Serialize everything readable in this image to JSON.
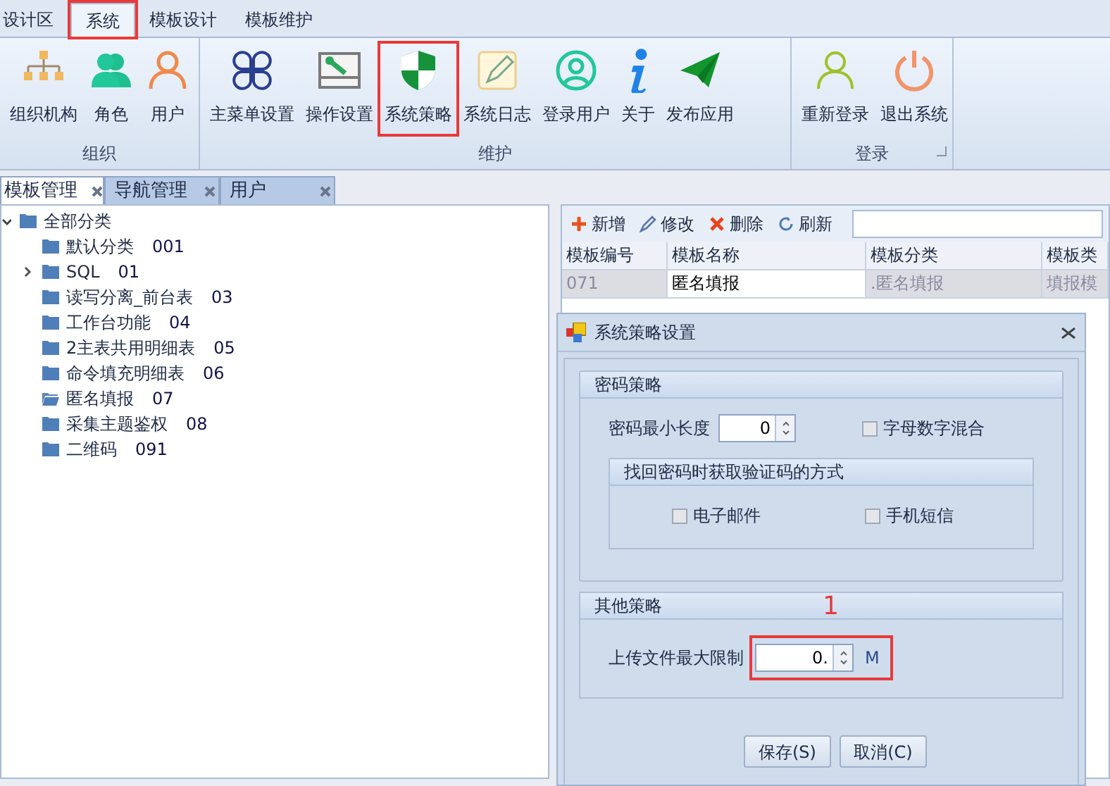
{
  "ribbon_tabs": [
    {
      "label": "设计区",
      "selected": false
    },
    {
      "label": "系统",
      "selected": true,
      "highlighted": true
    },
    {
      "label": "模板设计",
      "selected": false
    },
    {
      "label": "模板维护",
      "selected": false
    }
  ],
  "ribbon_groups": [
    {
      "label": "组织",
      "buttons": [
        {
          "label": "组织机构",
          "highlighted": false
        },
        {
          "label": "角色",
          "highlighted": false
        },
        {
          "label": "用户",
          "highlighted": false
        }
      ]
    },
    {
      "label": "维护",
      "buttons": [
        {
          "label": "主菜单设置",
          "highlighted": false
        },
        {
          "label": "操作设置",
          "highlighted": false
        },
        {
          "label": "系统策略",
          "highlighted": true
        },
        {
          "label": "系统日志",
          "highlighted": false
        },
        {
          "label": "登录用户",
          "highlighted": false
        },
        {
          "label": "关于",
          "highlighted": false
        },
        {
          "label": "发布应用",
          "highlighted": false
        }
      ]
    },
    {
      "label": "登录",
      "buttons": [
        {
          "label": "重新登录",
          "highlighted": false
        },
        {
          "label": "退出系统",
          "highlighted": false
        }
      ]
    }
  ],
  "doc_tabs": [
    {
      "label": "模板管理",
      "selected": true
    },
    {
      "label": "导航管理",
      "selected": false
    },
    {
      "label": "用户",
      "selected": false
    }
  ],
  "tree": {
    "label": "全部分类",
    "expanded": true,
    "children": [
      {
        "label": "默认分类",
        "code": "001",
        "expandable": false,
        "selected": false
      },
      {
        "label": "SQL",
        "code": "01",
        "expandable": true,
        "selected": false
      },
      {
        "label": "读写分离_前台表",
        "code": "03",
        "expandable": false,
        "selected": false
      },
      {
        "label": "工作台功能",
        "code": "04",
        "expandable": false,
        "selected": false
      },
      {
        "label": "2主表共用明细表",
        "code": "05",
        "expandable": false,
        "selected": false
      },
      {
        "label": "命令填充明细表",
        "code": "06",
        "expandable": false,
        "selected": false
      },
      {
        "label": "匿名填报",
        "code": "07",
        "expandable": false,
        "selected": true
      },
      {
        "label": "采集主题鉴权",
        "code": "08",
        "expandable": false,
        "selected": false
      },
      {
        "label": "二维码",
        "code": "091",
        "expandable": false,
        "selected": false
      }
    ]
  },
  "toolbar": [
    "新增",
    "修改",
    "删除",
    "刷新"
  ],
  "table": {
    "columns": [
      "模板编号",
      "模板名称",
      "模板分类",
      "模板类"
    ],
    "rows": [
      {
        "cells": [
          "071",
          "匿名填报",
          ".匿名填报",
          "填报模"
        ],
        "selected": true
      }
    ]
  },
  "dialog": {
    "title": "系统策略设置",
    "password_policy": {
      "title": "密码策略",
      "min_length_label": "密码最小长度",
      "min_length": "0",
      "mixed_label": "字母数字混合",
      "mixed": false,
      "recovery": {
        "title": "找回密码时获取验证码的方式",
        "options": [
          {
            "label": "电子邮件",
            "checked": false
          },
          {
            "label": "手机短信",
            "checked": false
          }
        ]
      }
    },
    "other_policy": {
      "title": "其他策略",
      "upload_label": "上传文件最大限制",
      "upload_value": "0.",
      "unit": "M",
      "highlighted": true,
      "annotation": "1"
    },
    "buttons": [
      "保存(S)",
      "取消(C)"
    ]
  }
}
